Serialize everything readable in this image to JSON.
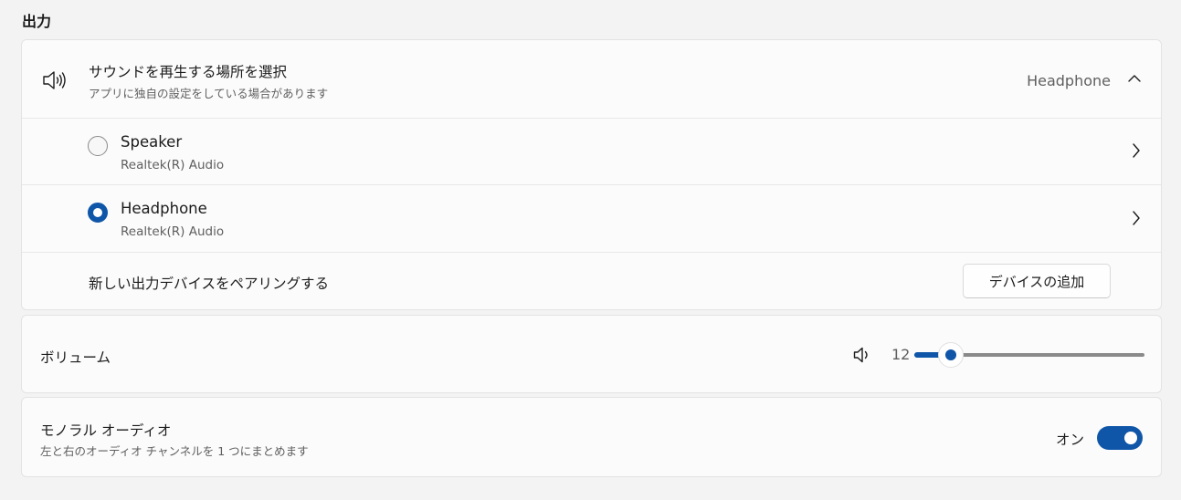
{
  "section": {
    "title": "出力"
  },
  "output": {
    "title": "サウンドを再生する場所を選択",
    "subtitle": "アプリに独自の設定をしている場合があります",
    "selected_value": "Headphone",
    "devices": [
      {
        "name": "Speaker",
        "description": "Realtek(R) Audio",
        "selected": false
      },
      {
        "name": "Headphone",
        "description": "Realtek(R) Audio",
        "selected": true
      }
    ],
    "pair": {
      "label": "新しい出力デバイスをペアリングする",
      "button_label": "デバイスの追加"
    }
  },
  "volume": {
    "label": "ボリューム",
    "value": "12",
    "level_percent": 12
  },
  "mono": {
    "title": "モノラル オーディオ",
    "subtitle": "左と右のオーディオ チャンネルを 1 つにまとめます",
    "state_label": "オン",
    "on": true
  },
  "colors": {
    "accent": "#0f56a8",
    "background": "#f3f3f3",
    "card": "#fbfbfb"
  },
  "icons": {
    "output": "speaker-icon",
    "collapse": "chevron-up-icon",
    "device_open": "chevron-right-icon",
    "volume": "volume-icon"
  }
}
